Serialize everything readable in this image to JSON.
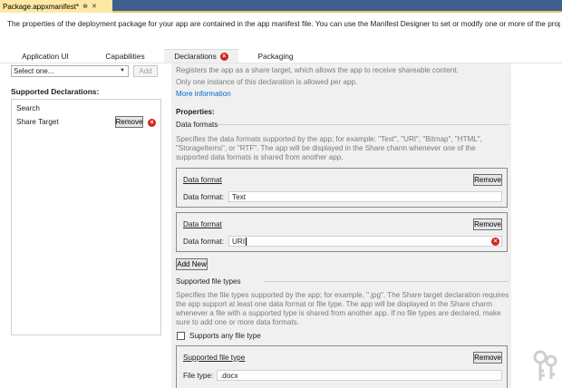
{
  "document_tab": {
    "title": "Package.appxmanifest*",
    "pin_icon": "pin-icon",
    "close_icon": "close-icon"
  },
  "intro": "The properties of the deployment package for your app are contained in the app manifest file. You can use the Manifest Designer to set or modify one or more of the properties.",
  "tabs": [
    {
      "label": "Application UI"
    },
    {
      "label": "Capabilities"
    },
    {
      "label": "Declarations",
      "active": true,
      "error": true
    },
    {
      "label": "Packaging"
    }
  ],
  "left": {
    "select_value": "Select one...",
    "add_label": "Add",
    "supported_label": "Supported Declarations:",
    "items": [
      {
        "label": "Search"
      },
      {
        "label": "Share Target",
        "remove_label": "Remove",
        "error": true
      }
    ]
  },
  "right": {
    "desc1": "Registers the app as a share target, which allows the app to receive shareable content.",
    "desc2": "Only one instance of this declaration is allowed per app.",
    "more_info": "More information",
    "properties_label": "Properties:",
    "data_formats_label": "Data formats",
    "data_formats_desc": "Specifies the data formats supported by the app; for example: \"Text\", \"URI\", \"Bitmap\", \"HTML\", \"StorageItems\", or \"RTF\". The app will be displayed in the Share charm whenever one of the supported data formats is shared from another app.",
    "data_formats": [
      {
        "header": "Data format",
        "remove_label": "Remove",
        "field_label": "Data format:",
        "value": "Text",
        "error": false
      },
      {
        "header": "Data format",
        "remove_label": "Remove",
        "field_label": "Data format:",
        "value": "URI",
        "error": true
      }
    ],
    "add_new_label": "Add New",
    "file_types_label": "Supported file types",
    "file_types_desc": "Specifies the file types supported by the app; for example, \".jpg\". The Share target declaration requires the app support at least one data format or file type. The app will be displayed in the Share charm whenever a file with a supported type is shared from another app. If no file types are declared, make sure to add one or more data formats.",
    "supports_any_label": "Supports any file type",
    "file_type": {
      "header": "Supported file type",
      "remove_label": "Remove",
      "field_label": "File type:",
      "value": ".docx"
    }
  },
  "colors": {
    "tab_strip": "#3f5f8f",
    "doc_tab": "#fde9a3",
    "error": "#d4241c",
    "link": "#0066cc",
    "pane": "#f0f0f0"
  },
  "icons": {
    "error": "error-icon",
    "dropdown": "chevron-down-icon",
    "watermark": "keys-icon"
  }
}
